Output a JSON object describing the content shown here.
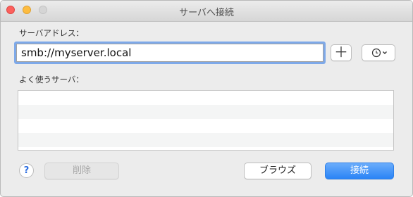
{
  "window": {
    "title": "サーバへ接続"
  },
  "address": {
    "label": "サーバアドレス：",
    "value": "smb://myserver.local",
    "add_label": "＋"
  },
  "favorites": {
    "label": "よく使うサーバ：",
    "items": []
  },
  "footer": {
    "help_label": "?",
    "delete_label": "削除",
    "browse_label": "ブラウズ",
    "connect_label": "接続"
  },
  "colors": {
    "accent": "#2a84f6",
    "focus_ring": "#7ea9e9",
    "close": "#fc605c",
    "minimize": "#fdbc40",
    "zoom_disabled": "#d5d5d5"
  },
  "icons": {
    "recent": "clock-icon",
    "dropdown": "chevron-down-icon"
  }
}
